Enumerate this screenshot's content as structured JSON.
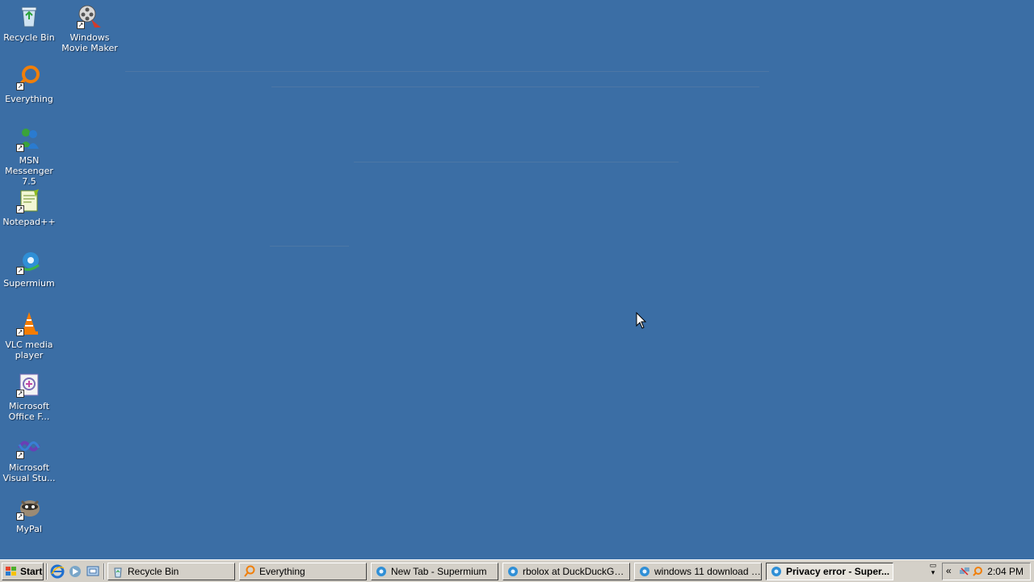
{
  "desktop": {
    "background_color": "#3b6ea5",
    "icons": [
      {
        "id": "recycle-bin",
        "label": "Recycle Bin",
        "icon": "recycle-bin-icon"
      },
      {
        "id": "windows-movie-maker",
        "label": "Windows Movie Maker",
        "icon": "movie-maker-icon"
      },
      {
        "id": "everything",
        "label": "Everything",
        "icon": "everything-icon"
      },
      {
        "id": "msn-messenger",
        "label": "MSN Messenger 7.5",
        "icon": "msn-messenger-icon"
      },
      {
        "id": "notepad-plus-plus",
        "label": "Notepad++",
        "icon": "notepad-plus-plus-icon"
      },
      {
        "id": "supermium",
        "label": "Supermium",
        "icon": "supermium-icon"
      },
      {
        "id": "vlc",
        "label": "VLC media player",
        "icon": "vlc-icon"
      },
      {
        "id": "ms-office-f",
        "label": "Microsoft Office F...",
        "icon": "office-icon"
      },
      {
        "id": "ms-visual-studio",
        "label": "Microsoft Visual Stu...",
        "icon": "visual-studio-icon"
      },
      {
        "id": "mypal",
        "label": "MyPal",
        "icon": "mypal-icon"
      }
    ]
  },
  "taskbar": {
    "start_label": "Start",
    "quick_launch": [
      "internet-explorer-icon",
      "media-icon",
      "show-desktop-icon"
    ],
    "tasks": [
      {
        "label": "Recycle Bin",
        "icon": "recycle-bin-icon",
        "active": false
      },
      {
        "label": "Everything",
        "icon": "everything-icon",
        "active": false
      },
      {
        "label": "New Tab - Supermium",
        "icon": "supermium-icon",
        "active": false
      },
      {
        "label": "rbolox at DuckDuckGo - ...",
        "icon": "supermium-icon",
        "active": false
      },
      {
        "label": "windows 11 download at...",
        "icon": "supermium-icon",
        "active": false
      },
      {
        "label": "Privacy error - Super...",
        "icon": "supermium-icon",
        "active": true
      }
    ],
    "tray": {
      "chevron": "«",
      "clock": "2:04 PM"
    }
  }
}
